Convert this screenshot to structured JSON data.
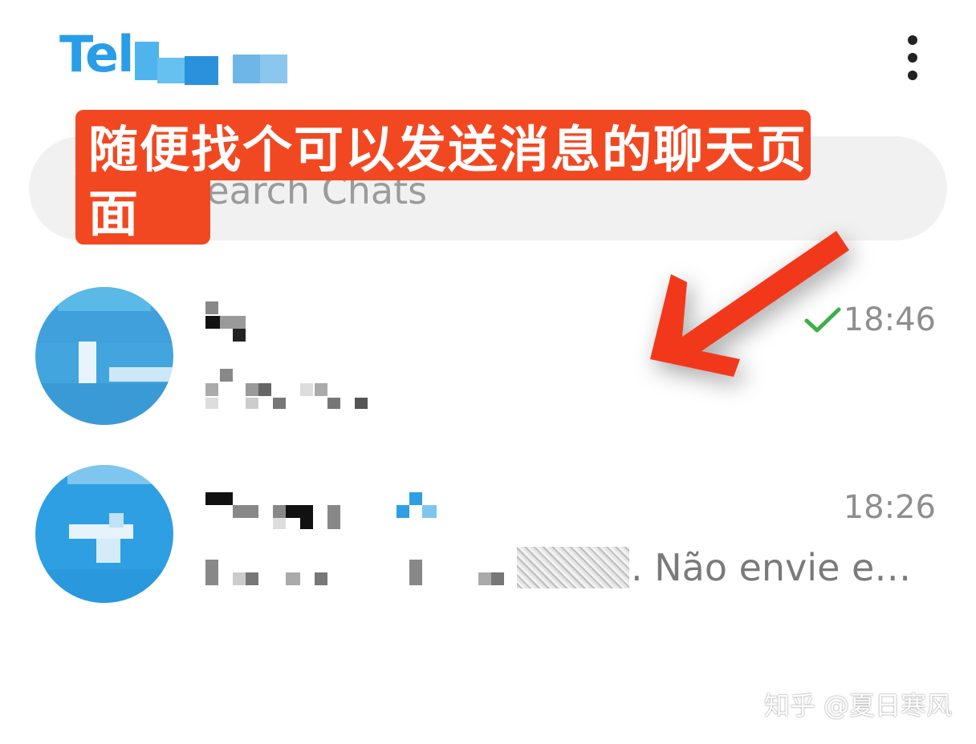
{
  "header": {
    "title": "Tel",
    "menu_icon": "more-vertical-icon"
  },
  "search": {
    "placeholder": "Search Chats",
    "icon": "search-icon"
  },
  "annotation": {
    "text": "随便找个可以发送消息的聊天页面",
    "color": "#f24822"
  },
  "chats": [
    {
      "time": "18:46",
      "status": "sent-check-icon"
    },
    {
      "time": "18:26",
      "preview_suffix": ". Não envie e…"
    }
  ],
  "watermark": "知乎 @夏日寒风",
  "colors": {
    "accent": "#2a9de8",
    "check": "#3fae4a",
    "annotation": "#f24822"
  }
}
